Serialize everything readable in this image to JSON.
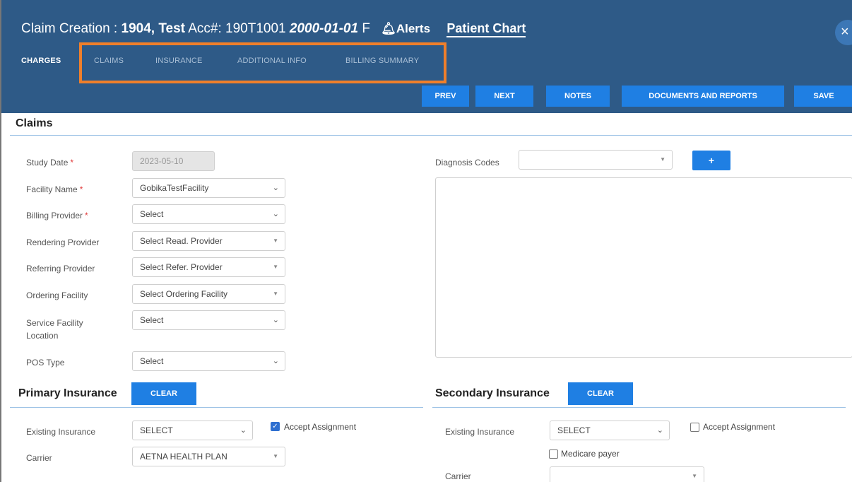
{
  "header": {
    "title_prefix": "Claim Creation : ",
    "patient": "1904, Test",
    "acc_label": " Acc#: 190T1001 ",
    "dob": "2000-01-01",
    "sex": " F",
    "alerts_label": "Alerts",
    "patient_chart_label": "Patient Chart",
    "close_icon": "×"
  },
  "tabs": [
    {
      "label": "CHARGES",
      "active": true
    },
    {
      "label": "CLAIMS",
      "active": false
    },
    {
      "label": "INSURANCE",
      "active": false
    },
    {
      "label": "ADDITIONAL INFO",
      "active": false
    },
    {
      "label": "BILLING SUMMARY",
      "active": false
    }
  ],
  "toolbar": {
    "prev": "PREV",
    "next": "NEXT",
    "notes": "NOTES",
    "documents": "DOCUMENTS AND REPORTS",
    "save": "SAVE"
  },
  "claims": {
    "title": "Claims",
    "study_date": {
      "label": "Study Date",
      "value": "2023-05-10"
    },
    "facility_name": {
      "label": "Facility Name",
      "value": "GobikaTestFacility"
    },
    "billing_provider": {
      "label": "Billing Provider",
      "value": "Select"
    },
    "rendering_provider": {
      "label": "Rendering Provider",
      "value": "Select Read. Provider"
    },
    "referring_provider": {
      "label": "Referring Provider",
      "value": "Select Refer. Provider"
    },
    "ordering_facility": {
      "label": "Ordering Facility",
      "value": "Select Ordering Facility"
    },
    "service_facility": {
      "label_line1": "Service Facility",
      "label_line2": "Location",
      "value": "Select"
    },
    "pos_type": {
      "label": "POS Type",
      "value": "Select"
    },
    "required_mark": "*",
    "diagnosis_codes": {
      "label": "Diagnosis Codes",
      "value": ""
    },
    "add_label": "+"
  },
  "primary_insurance": {
    "title": "Primary Insurance",
    "clear_label": "CLEAR",
    "existing_label": "Existing Insurance",
    "existing_value": "SELECT",
    "accept_assignment": "Accept Assignment",
    "accept_checked": true,
    "carrier_label": "Carrier",
    "carrier_value": "AETNA HEALTH PLAN"
  },
  "secondary_insurance": {
    "title": "Secondary Insurance",
    "clear_label": "CLEAR",
    "existing_label": "Existing Insurance",
    "existing_value": "SELECT",
    "accept_assignment": "Accept Assignment",
    "accept_checked": false,
    "medicare_payer": "Medicare payer",
    "medicare_checked": false,
    "carrier_label": "Carrier",
    "carrier_value": ""
  },
  "colors": {
    "header_bg": "#2e5a87",
    "button_blue": "#1f7fe3",
    "highlight_orange": "#f07f2a",
    "required_red": "#e13b3b"
  }
}
